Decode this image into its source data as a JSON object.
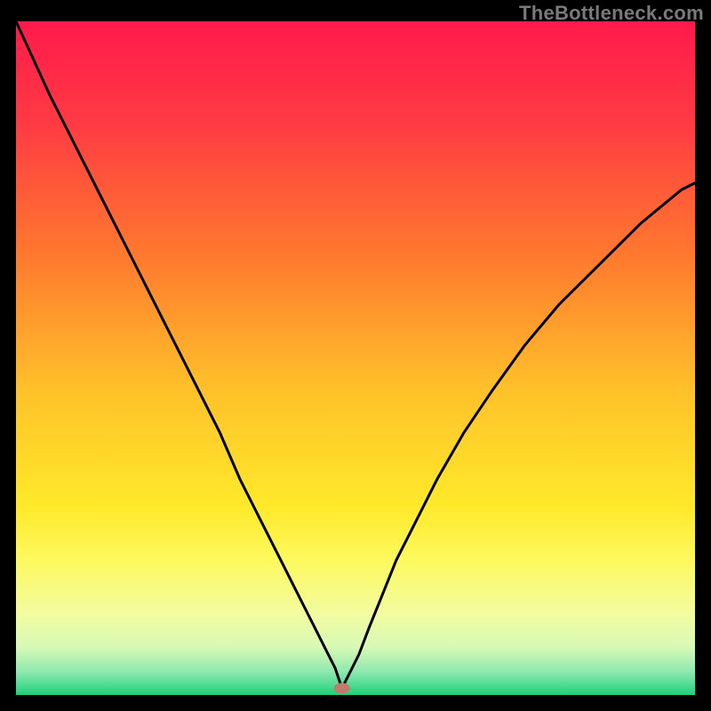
{
  "watermark": "TheBottleneck.com",
  "chart_data": {
    "type": "line",
    "title": "",
    "xlabel": "",
    "ylabel": "",
    "xlim": [
      0,
      100
    ],
    "ylim": [
      0,
      100
    ],
    "marker": {
      "x": 48,
      "y": 1,
      "color": "#c47a6a"
    },
    "curve": {
      "x": [
        0,
        5,
        10,
        15,
        20,
        25,
        30,
        33,
        36,
        39,
        41,
        43,
        44.5,
        46,
        47,
        48,
        49,
        50.5,
        52,
        54,
        56,
        59,
        62,
        66,
        70,
        75,
        80,
        86,
        92,
        98,
        100
      ],
      "y": [
        100,
        89,
        79,
        69,
        59,
        49,
        39,
        32,
        26,
        20,
        16,
        12,
        9,
        6,
        4,
        1,
        3,
        6,
        10,
        15,
        20,
        26,
        32,
        39,
        45,
        52,
        58,
        64,
        70,
        75,
        76
      ]
    },
    "background_gradient": {
      "stops": [
        {
          "offset": 0.0,
          "color": "#ff1a4b"
        },
        {
          "offset": 0.15,
          "color": "#ff3a43"
        },
        {
          "offset": 0.35,
          "color": "#ff7a2e"
        },
        {
          "offset": 0.55,
          "color": "#ffc22a"
        },
        {
          "offset": 0.72,
          "color": "#ffe92a"
        },
        {
          "offset": 0.8,
          "color": "#fdf95f"
        },
        {
          "offset": 0.88,
          "color": "#f3fca0"
        },
        {
          "offset": 0.93,
          "color": "#d6f9b6"
        },
        {
          "offset": 0.965,
          "color": "#8fe9b0"
        },
        {
          "offset": 1.0,
          "color": "#1fd07a"
        }
      ]
    }
  }
}
